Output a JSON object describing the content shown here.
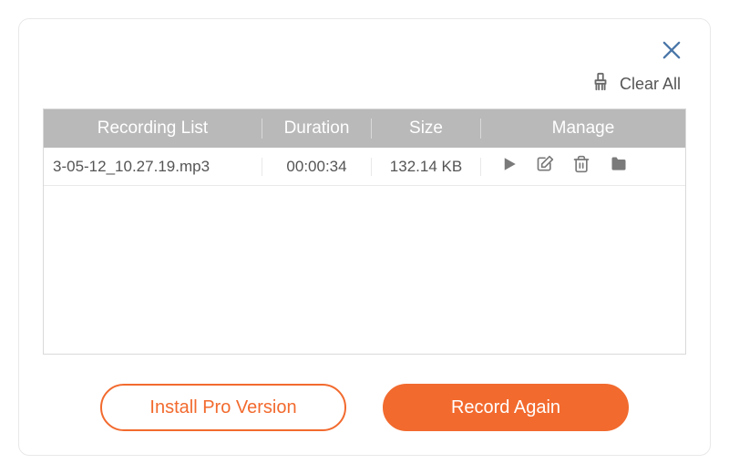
{
  "accent_color": "#f26a2e",
  "toolbar": {
    "clear_all_label": "Clear All"
  },
  "table": {
    "headers": {
      "name": "Recording List",
      "duration": "Duration",
      "size": "Size",
      "manage": "Manage"
    },
    "rows": [
      {
        "name": "3-05-12_10.27.19.mp3",
        "duration": "00:00:34",
        "size": "132.14 KB"
      }
    ]
  },
  "footer": {
    "install_pro_label": "Install Pro Version",
    "record_again_label": "Record Again"
  }
}
